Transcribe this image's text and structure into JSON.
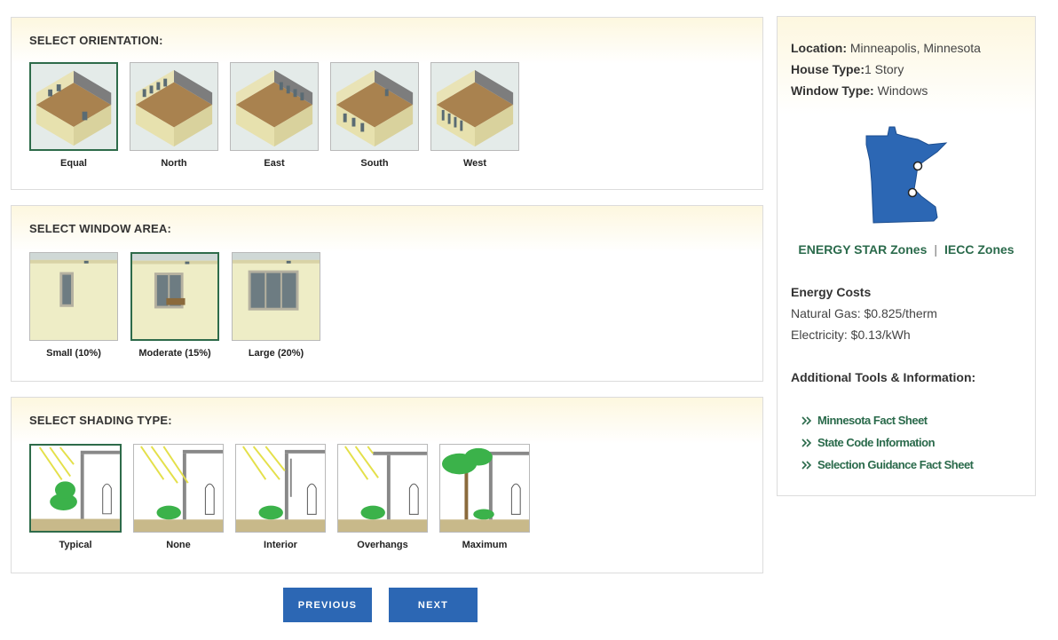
{
  "orientation": {
    "title": "SELECT ORIENTATION:",
    "options": [
      {
        "label": "Equal",
        "selected": true
      },
      {
        "label": "North",
        "selected": false
      },
      {
        "label": "East",
        "selected": false
      },
      {
        "label": "South",
        "selected": false
      },
      {
        "label": "West",
        "selected": false
      }
    ]
  },
  "window_area": {
    "title": "SELECT WINDOW AREA:",
    "options": [
      {
        "label": "Small (10%)",
        "selected": false
      },
      {
        "label": "Moderate (15%)",
        "selected": true
      },
      {
        "label": "Large (20%)",
        "selected": false
      }
    ]
  },
  "shading": {
    "title": "SELECT SHADING TYPE:",
    "options": [
      {
        "label": "Typical",
        "selected": true
      },
      {
        "label": "None",
        "selected": false
      },
      {
        "label": "Interior",
        "selected": false
      },
      {
        "label": "Overhangs",
        "selected": false
      },
      {
        "label": "Maximum",
        "selected": false
      }
    ]
  },
  "buttons": {
    "previous": "PREVIOUS",
    "next": "NEXT"
  },
  "sidebar": {
    "location_label": "Location:",
    "location_value": "Minneapolis, Minnesota",
    "house_type_label": "House Type:",
    "house_type_value": "1 Story",
    "window_type_label": "Window Type:",
    "window_type_value": "Windows",
    "map_state": "Minnesota",
    "energy_star_zones": "ENERGY STAR Zones",
    "zones_separator": "|",
    "iecc_zones": "IECC Zones",
    "energy_costs_title": "Energy Costs",
    "natural_gas": "Natural Gas: $0.825/therm",
    "electricity": "Electricity: $0.13/kWh",
    "tools_title": "Additional Tools & Information:",
    "tools": [
      {
        "label": "Minnesota Fact Sheet"
      },
      {
        "label": "State Code Information"
      },
      {
        "label": "Selection Guidance Fact Sheet"
      }
    ]
  },
  "colors": {
    "accent_green": "#2a6a4b",
    "button_blue": "#2c67b4",
    "map_blue": "#2c67b4"
  }
}
